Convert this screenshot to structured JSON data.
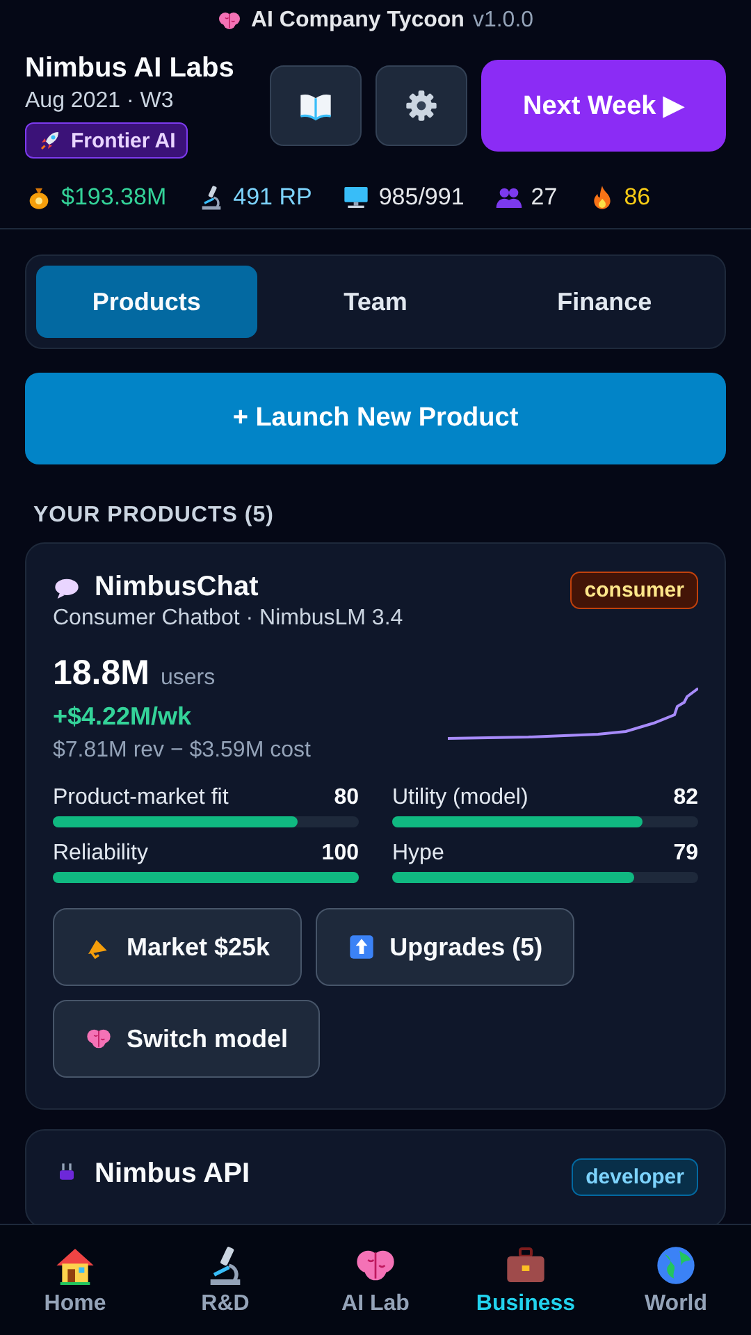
{
  "app_title": {
    "name": "AI Company Tycoon",
    "version": "v1.0.0"
  },
  "company": {
    "name": "Nimbus AI Labs",
    "date": "Aug 2021 · W3",
    "tier": "Frontier AI"
  },
  "next_week": "Next Week ▶",
  "stats": [
    {
      "kind": "money",
      "value": "$193.38M",
      "color": "#34d399"
    },
    {
      "kind": "research",
      "value": "491 RP",
      "color": "#7dd3fc"
    },
    {
      "kind": "compute",
      "value": "985/991",
      "color": "#e5e7eb"
    },
    {
      "kind": "staff",
      "value": "27",
      "color": "#e5e7eb"
    },
    {
      "kind": "hype",
      "value": "86",
      "color": "#facc15"
    }
  ],
  "tabs": [
    {
      "label": "Products",
      "selected": true
    },
    {
      "label": "Team",
      "selected": false
    },
    {
      "label": "Finance",
      "selected": false
    }
  ],
  "launch_button": "+ Launch New Product",
  "section_title": "YOUR PRODUCTS (5)",
  "products": [
    {
      "kind": "chat",
      "name": "NimbusChat",
      "tag": "consumer",
      "subtitle": "Consumer Chatbot · NimbusLM 3.4",
      "users": "18.8M",
      "users_label": "users",
      "profit": "+$4.22M/wk",
      "breakdown": "$7.81M rev − $3.59M cost",
      "metrics": [
        {
          "label": "Product-market fit",
          "value": "80",
          "level": 0.8
        },
        {
          "label": "Utility (model)",
          "value": "82",
          "level": 0.82
        },
        {
          "label": "Reliability",
          "value": "100",
          "level": 1
        },
        {
          "label": "Hype",
          "value": "79",
          "level": 0.79
        }
      ],
      "actions": [
        {
          "kind": "market",
          "label": "Market $25k"
        },
        {
          "kind": "upgrades",
          "label": "Upgrades (5)"
        },
        {
          "kind": "switch",
          "label": "Switch model"
        }
      ]
    },
    {
      "kind": "api",
      "name": "Nimbus API",
      "tag": "developer"
    }
  ],
  "nav": [
    {
      "kind": "home",
      "label": "Home",
      "selected": false
    },
    {
      "kind": "rnd",
      "label": "R&D",
      "selected": false
    },
    {
      "kind": "lab",
      "label": "AI Lab",
      "selected": false
    },
    {
      "kind": "business",
      "label": "Business",
      "selected": true
    },
    {
      "kind": "world",
      "label": "World",
      "selected": false
    }
  ]
}
